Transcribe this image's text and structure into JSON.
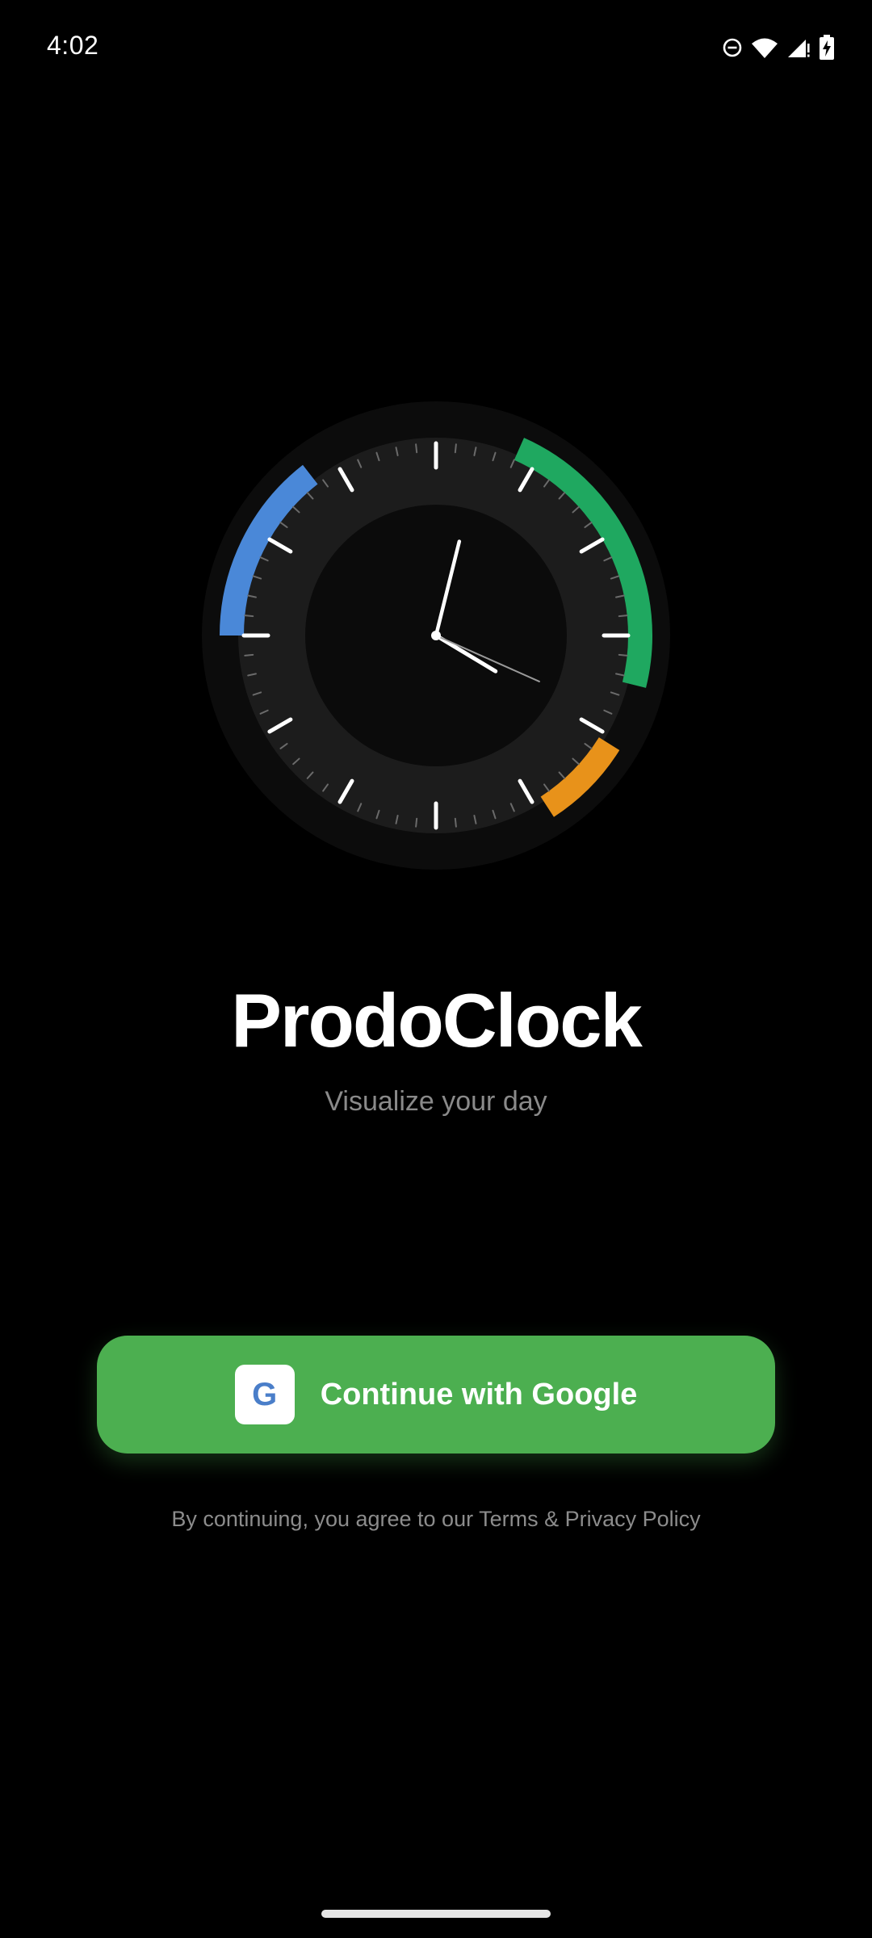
{
  "status_bar": {
    "time": "4:02",
    "icons": [
      "do-not-disturb-icon",
      "wifi-icon",
      "cellular-signal-icon",
      "battery-charging-icon"
    ]
  },
  "clock": {
    "time_shown": "4:02:19",
    "segment_colors": {
      "blue": "#4a88d8",
      "green": "#1fa860",
      "orange": "#e8921a"
    }
  },
  "app": {
    "title": "ProdoClock",
    "subtitle": "Visualize your day"
  },
  "google_button": {
    "logo_letter": "G",
    "label": "Continue with Google",
    "color": "#4caf50"
  },
  "legal": {
    "text": "By continuing, you agree to our Terms & Privacy Policy"
  }
}
